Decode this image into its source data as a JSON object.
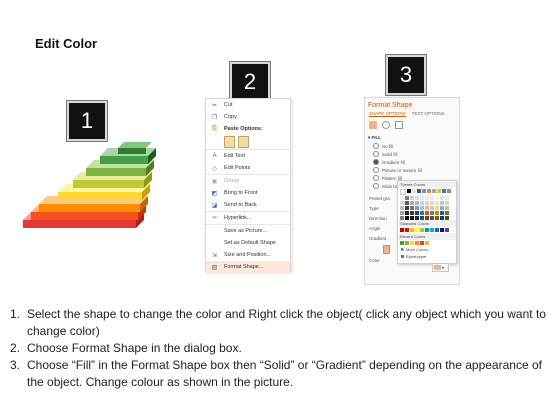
{
  "title": "Edit Color",
  "badges": [
    "1",
    "2",
    "3"
  ],
  "context_menu": {
    "items": [
      {
        "icon": "scissors-icon",
        "label": "Cut",
        "style": "normal"
      },
      {
        "icon": "copy-icon",
        "label": "Copy",
        "style": "normal"
      },
      {
        "icon": "paste-icon",
        "label": "Paste Options:",
        "style": "bold"
      },
      {
        "icon": "edit-text-icon",
        "label": "Edit Text",
        "style": "normal",
        "sep": true
      },
      {
        "icon": "edit-points-icon",
        "label": "Edit Points",
        "style": "normal"
      },
      {
        "icon": "group-icon",
        "label": "Group",
        "style": "disabled",
        "sep": true
      },
      {
        "icon": "bring-front-icon",
        "label": "Bring to Front",
        "style": "normal"
      },
      {
        "icon": "send-back-icon",
        "label": "Send to Back",
        "style": "normal"
      },
      {
        "icon": "hyperlink-icon",
        "label": "Hyperlink...",
        "style": "normal",
        "sep": true
      },
      {
        "icon": "",
        "label": "Save as Picture...",
        "style": "normal",
        "sep": true
      },
      {
        "icon": "",
        "label": "Set as Default Shape",
        "style": "normal"
      },
      {
        "icon": "size-icon",
        "label": "Size and Position...",
        "style": "normal"
      },
      {
        "icon": "format-shape-icon",
        "label": "Format Shape...",
        "style": "highlight"
      }
    ]
  },
  "format_panel": {
    "title": "Format Shape",
    "tabs": [
      "SHAPE OPTIONS",
      "TEXT OPTIONS"
    ],
    "section": "FILL",
    "options": [
      {
        "label": "No fill",
        "selected": false
      },
      {
        "label": "Solid fill",
        "selected": false
      },
      {
        "label": "Gradient fill",
        "selected": true
      },
      {
        "label": "Picture or texture fill",
        "selected": false
      },
      {
        "label": "Pattern fill",
        "selected": false
      },
      {
        "label": "Slide background fill",
        "selected": false
      }
    ],
    "left_labels": [
      "Preset gra",
      "Type",
      "Direction",
      "Angle",
      "Gradient"
    ],
    "color_label": "Color",
    "popup": {
      "theme_header": "Theme Colors",
      "standard_header": "Standard Colors",
      "recent_header": "Recent Colors",
      "more_colors": "More Colors...",
      "eyedropper": "Eyedropper"
    },
    "colors": {
      "accent": "#c55a11",
      "fill_swatch": "#f4b183"
    }
  },
  "instructions": [
    {
      "num": "1.",
      "text": "Select the shape to change the color and Right click the object( click any object which you want to change color)"
    },
    {
      "num": "2.",
      "text": "Choose Format Shape in the dialog box."
    },
    {
      "num": "3.",
      "text": "Choose “Fill” in the Format Shape box then “Solid” or “Gradient” depending on the appearance of the object. Change colour as shown in the picture."
    }
  ]
}
